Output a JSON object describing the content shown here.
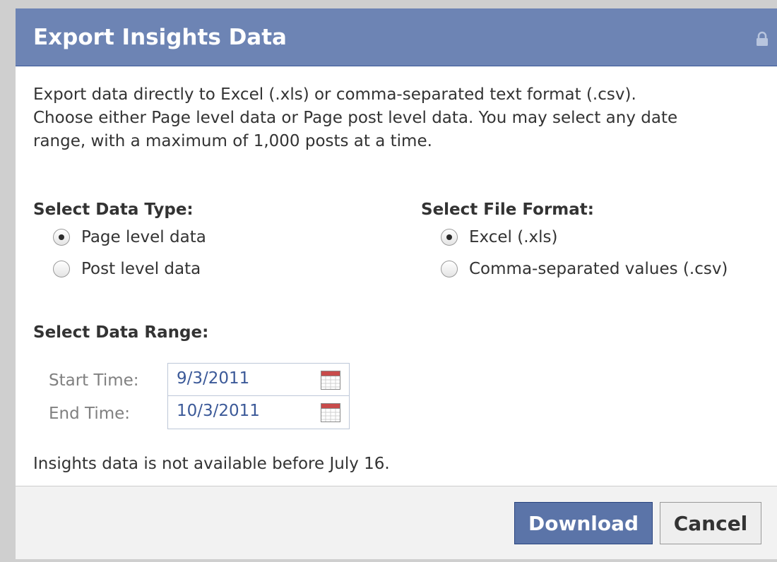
{
  "dialog": {
    "title": "Export Insights Data",
    "description": [
      "Export data directly to Excel (.xls) or comma-separated text format (.csv).",
      "Choose either Page level data or Page post level data. You may select any date",
      "range, with a maximum of 1,000 posts at a time."
    ],
    "lock_icon": "lock-icon"
  },
  "data_type": {
    "label": "Select Data Type:",
    "options": [
      "Page level data",
      "Post level data"
    ],
    "selected": "Page level data"
  },
  "file_format": {
    "label": "Select File Format:",
    "options": [
      "Excel (.xls)",
      "Comma-separated values (.csv)"
    ],
    "selected": "Excel (.xls)"
  },
  "data_range": {
    "label": "Select Data Range:",
    "start_label": "Start Time:",
    "start_value": "9/3/2011",
    "end_label": "End Time:",
    "end_value": "10/3/2011",
    "calendar_icon": "calendar-icon"
  },
  "note": "Insights data is not available before July 16.",
  "footer": {
    "download_label": "Download",
    "cancel_label": "Cancel"
  },
  "colors": {
    "titlebar": "#6d84b4",
    "link_blue": "#3b5998",
    "download_button": "#5b74a8"
  }
}
